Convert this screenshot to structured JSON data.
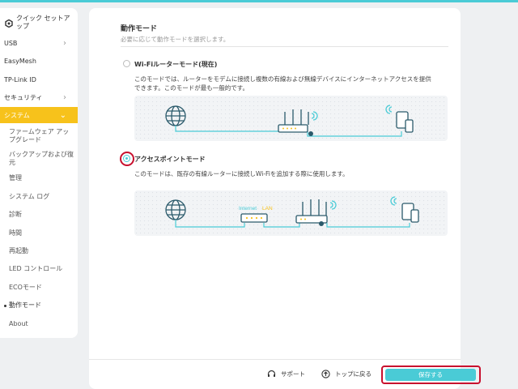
{
  "sidebar": {
    "quick_setup": "クイック セットアップ",
    "items": [
      {
        "label": "USB"
      },
      {
        "label": "EasyMesh"
      },
      {
        "label": "TP-Link ID"
      },
      {
        "label": "セキュリティ"
      },
      {
        "label": "システム"
      }
    ],
    "sub_items": [
      {
        "label": "ファームウェア アップグレード"
      },
      {
        "label": "バックアップおよび復元"
      },
      {
        "label": "管理"
      },
      {
        "label": "システム ログ"
      },
      {
        "label": "診断"
      },
      {
        "label": "時間"
      },
      {
        "label": "再起動"
      },
      {
        "label": "LED コントロール"
      },
      {
        "label": "ECOモード"
      },
      {
        "label": "動作モード"
      },
      {
        "label": "About"
      }
    ]
  },
  "main": {
    "title": "動作モード",
    "subtitle": "必要に応じて動作モードを選択します。",
    "router_mode": {
      "label": "Wi-Fiルーターモード(現在)",
      "desc_line1": "このモードでは、ルーターをモデムに接続し複数の有線および無線デバイスにインターネットアクセスを提供",
      "desc_line2": "できます。このモードが最も一般的です。"
    },
    "ap_mode": {
      "label": "アクセスポイントモード",
      "desc": "このモードは、既存の有線ルーターに接続しWi-Fiを追加する際に使用します。",
      "internet_label": "Internet",
      "lan_label": "LAN"
    }
  },
  "footer": {
    "support": "サポート",
    "back_to_top": "トップに戻る",
    "save": "保存する"
  },
  "colors": {
    "accent": "#4acbd6",
    "active": "#f7c21b",
    "highlight": "#c8102e"
  }
}
